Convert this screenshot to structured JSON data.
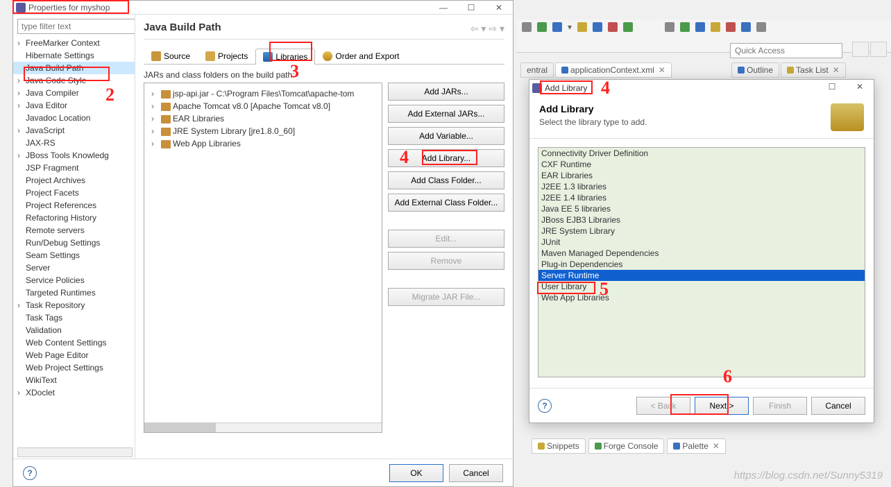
{
  "props": {
    "title": "Properties for myshop",
    "filter_placeholder": "type filter text",
    "categories": [
      {
        "label": "FreeMarker Context",
        "exp": true
      },
      {
        "label": "Hibernate Settings",
        "exp": false
      },
      {
        "label": "Java Build Path",
        "exp": false,
        "selected": true
      },
      {
        "label": "Java Code Style",
        "exp": true
      },
      {
        "label": "Java Compiler",
        "exp": true
      },
      {
        "label": "Java Editor",
        "exp": true
      },
      {
        "label": "Javadoc Location",
        "exp": false
      },
      {
        "label": "JavaScript",
        "exp": true
      },
      {
        "label": "JAX-RS",
        "exp": false
      },
      {
        "label": "JBoss Tools Knowledg",
        "exp": true
      },
      {
        "label": "JSP Fragment",
        "exp": false
      },
      {
        "label": "Project Archives",
        "exp": false
      },
      {
        "label": "Project Facets",
        "exp": false
      },
      {
        "label": "Project References",
        "exp": false
      },
      {
        "label": "Refactoring History",
        "exp": false
      },
      {
        "label": "Remote servers",
        "exp": false
      },
      {
        "label": "Run/Debug Settings",
        "exp": false
      },
      {
        "label": "Seam Settings",
        "exp": false
      },
      {
        "label": "Server",
        "exp": false
      },
      {
        "label": "Service Policies",
        "exp": false
      },
      {
        "label": "Targeted Runtimes",
        "exp": false
      },
      {
        "label": "Task Repository",
        "exp": true
      },
      {
        "label": "Task Tags",
        "exp": false
      },
      {
        "label": "Validation",
        "exp": false
      },
      {
        "label": "Web Content Settings",
        "exp": false
      },
      {
        "label": "Web Page Editor",
        "exp": false
      },
      {
        "label": "Web Project Settings",
        "exp": false
      },
      {
        "label": "WikiText",
        "exp": false
      },
      {
        "label": "XDoclet",
        "exp": true
      }
    ],
    "page_heading": "Java Build Path",
    "tabs": {
      "source": "Source",
      "projects": "Projects",
      "libraries": "Libraries",
      "order": "Order and Export"
    },
    "jar_caption": "JARs and class folders on the build path:",
    "jars": [
      "jsp-api.jar - C:\\Program Files\\Tomcat\\apache-tom",
      "Apache Tomcat v8.0 [Apache Tomcat v8.0]",
      "EAR Libraries",
      "JRE System Library [jre1.8.0_60]",
      "Web App Libraries"
    ],
    "buttons": {
      "add_jars": "Add JARs...",
      "add_ext_jars": "Add External JARs...",
      "add_var": "Add Variable...",
      "add_lib": "Add Library...",
      "add_class": "Add Class Folder...",
      "add_ext_class": "Add External Class Folder...",
      "edit": "Edit...",
      "remove": "Remove",
      "migrate": "Migrate JAR File..."
    },
    "ok": "OK",
    "cancel": "Cancel"
  },
  "lib": {
    "title": "Add Library",
    "heading": "Add Library",
    "subtitle": "Select the library type to add.",
    "items": [
      "Connectivity Driver Definition",
      "CXF Runtime",
      "EAR Libraries",
      "J2EE 1.3 libraries",
      "J2EE 1.4 libraries",
      "Java EE 5 libraries",
      "JBoss EJB3 Libraries",
      "JRE System Library",
      "JUnit",
      "Maven Managed Dependencies",
      "Plug-in Dependencies",
      "Server Runtime",
      "User Library",
      "Web App Libraries"
    ],
    "selected_index": 11,
    "back": "< Back",
    "next": "Next >",
    "finish": "Finish",
    "cancel": "Cancel"
  },
  "ide": {
    "quick_access": "Quick Access",
    "editor_tab_central": "entral",
    "editor_tab_app": "applicationContext.xml",
    "view_outline": "Outline",
    "view_tasklist": "Task List",
    "bottom_snippets": "Snippets",
    "bottom_forge": "Forge Console",
    "bottom_palette": "Palette"
  },
  "annotations": {
    "n2": "2",
    "n3": "3",
    "n4a": "4",
    "n4b": "4",
    "n5": "5",
    "n6": "6"
  },
  "watermark": "https://blog.csdn.net/Sunny5319"
}
